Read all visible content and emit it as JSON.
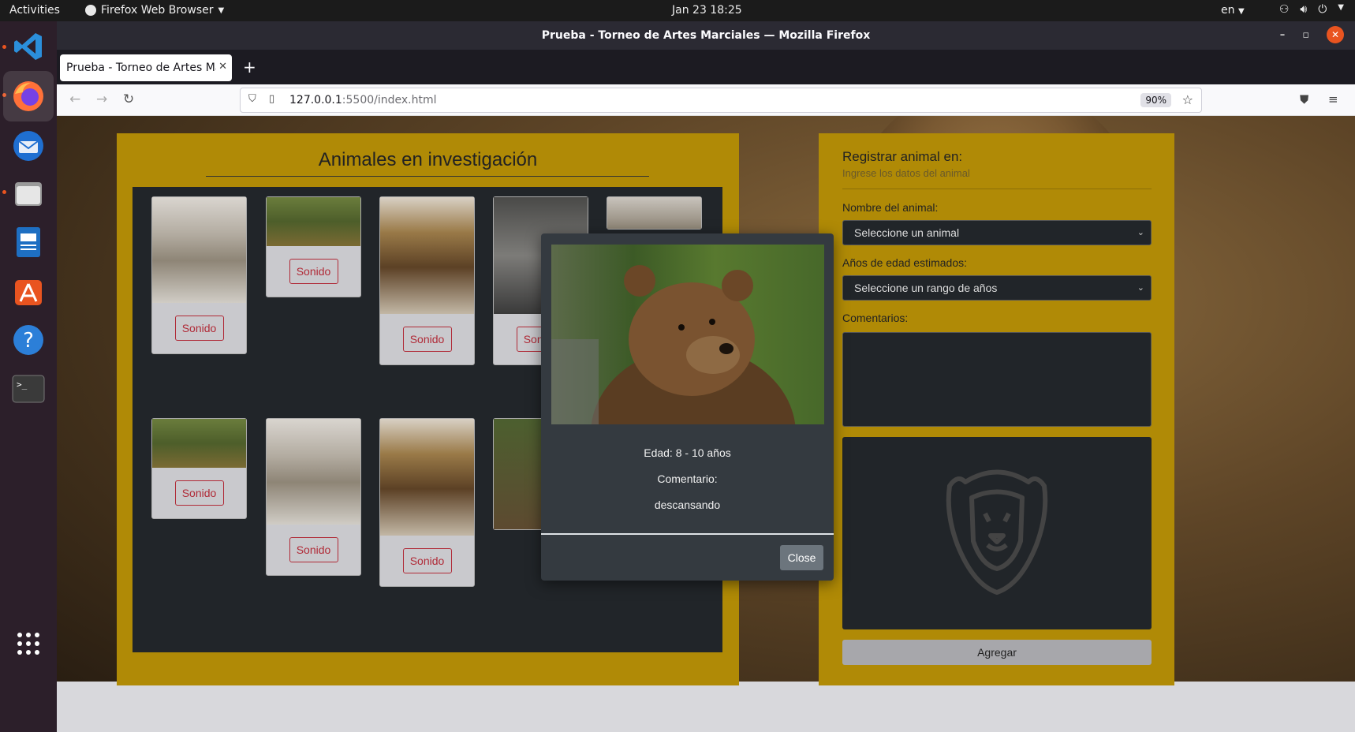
{
  "topbar": {
    "activities": "Activities",
    "app_menu": "Firefox Web Browser",
    "clock": "Jan 23  18:25",
    "lang": "en"
  },
  "window": {
    "title": "Prueba - Torneo de Artes Marciales — Mozilla Firefox",
    "tab_title": "Prueba - Torneo de Artes Ma",
    "url_host": "127.0.0.1",
    "url_path": ":5500/index.html",
    "zoom": "90%"
  },
  "page": {
    "gallery_title": "Animales en investigación",
    "sound_button_label": "Sonido",
    "form": {
      "title": "Registrar animal en:",
      "subtitle": "Ingrese los datos del animal",
      "animal_label": "Nombre del animal:",
      "animal_selected": "Seleccione un animal",
      "age_label": "Años de edad estimados:",
      "age_selected": "Seleccione un rango de años",
      "comments_label": "Comentarios:",
      "submit_label": "Agregar"
    },
    "modal": {
      "age_text": "Edad: 8 - 10 años",
      "comment_heading": "Comentario:",
      "comment_text": "descansando",
      "close_label": "Close"
    }
  },
  "colors": {
    "panel": "#b08a06",
    "dark": "#212529",
    "danger": "#b02a37",
    "modal_bg": "#343a40"
  }
}
